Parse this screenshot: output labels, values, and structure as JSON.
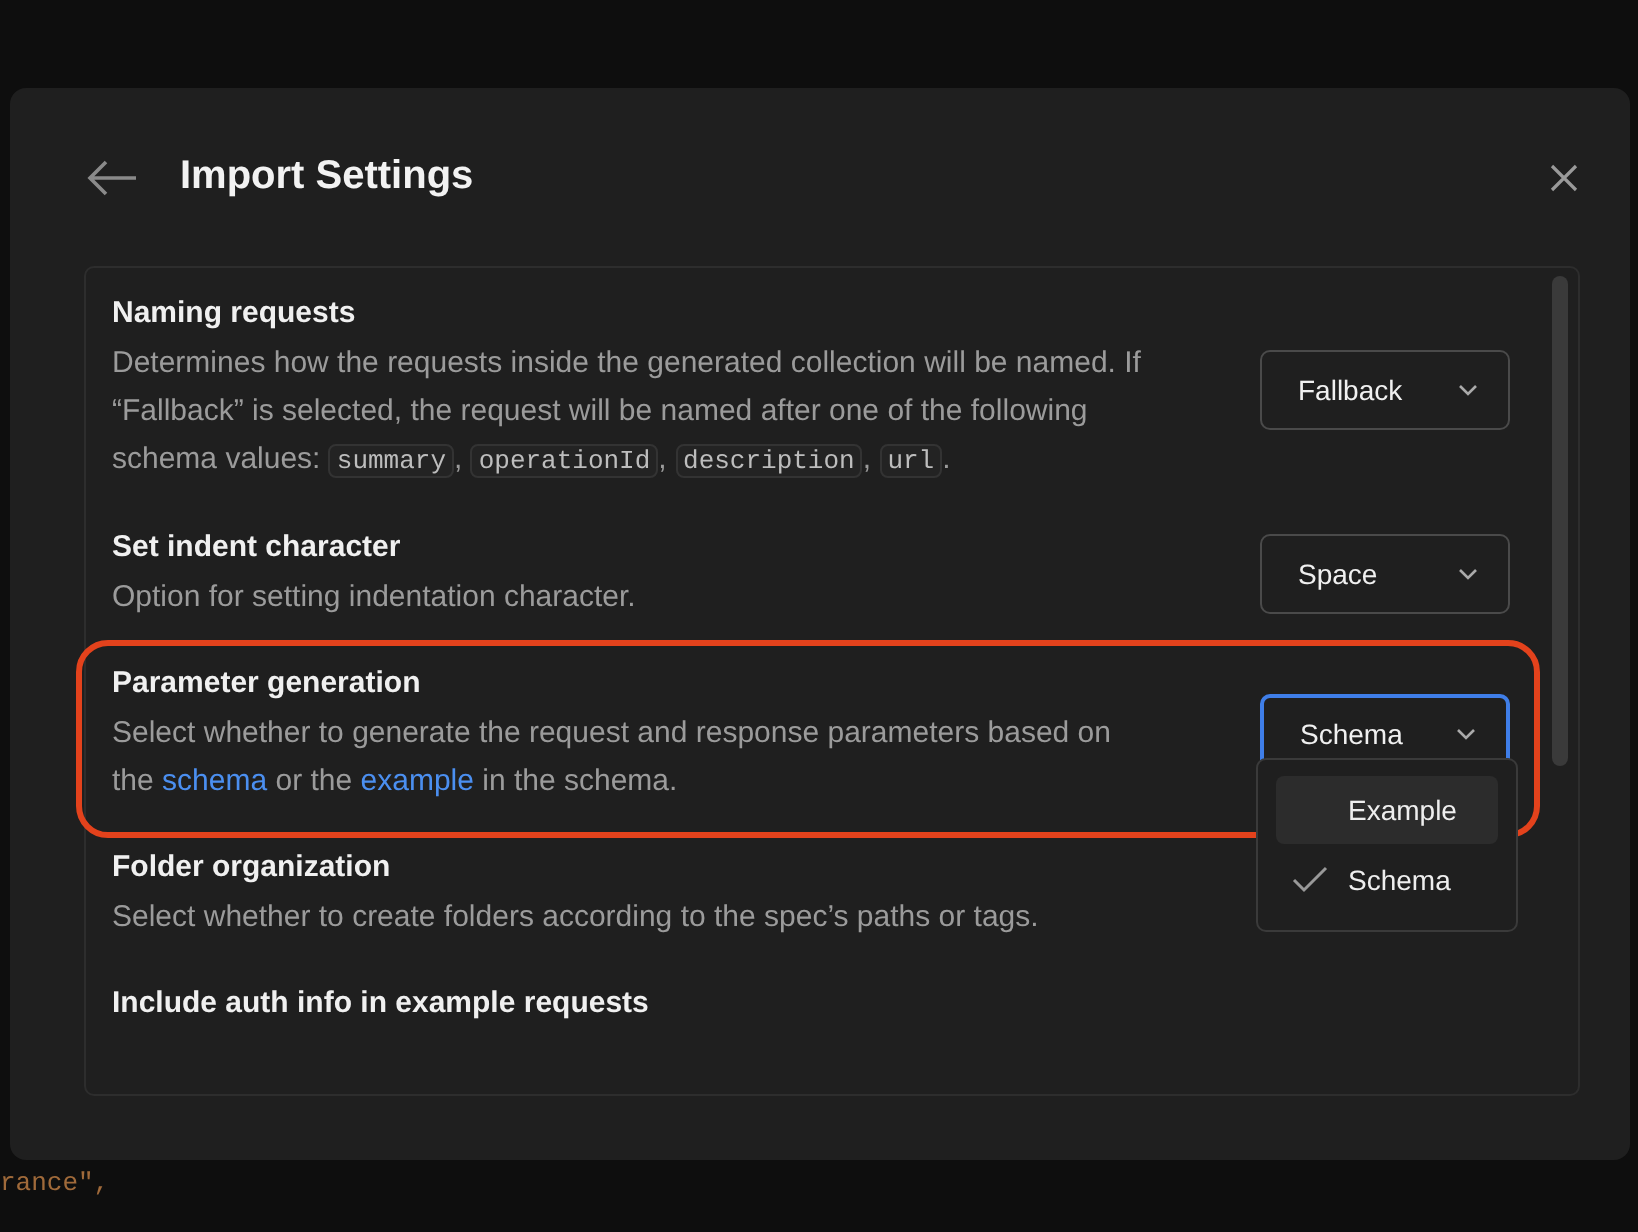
{
  "dialog": {
    "title": "Import Settings"
  },
  "settings": [
    {
      "title": "Naming requests",
      "highlighted": false,
      "description": [
        {
          "kind": "text",
          "text": "Determines how the requests inside the generated collection will be named. If “Fallback” is selected, the request will be named after one of the following schema values: "
        },
        {
          "kind": "code",
          "text": "summary"
        },
        {
          "kind": "text",
          "text": ", "
        },
        {
          "kind": "code",
          "text": "operationId"
        },
        {
          "kind": "text",
          "text": ", "
        },
        {
          "kind": "code",
          "text": "description"
        },
        {
          "kind": "text",
          "text": ", "
        },
        {
          "kind": "code",
          "text": "url"
        },
        {
          "kind": "text",
          "text": "."
        }
      ],
      "control": {
        "value": "Fallback",
        "focused": false
      }
    },
    {
      "title": "Set indent character",
      "highlighted": false,
      "description": [
        {
          "kind": "text",
          "text": "Option for setting indentation character."
        }
      ],
      "control": {
        "value": "Space",
        "focused": false
      }
    },
    {
      "title": "Parameter generation",
      "highlighted": true,
      "description": [
        {
          "kind": "text",
          "text": "Select whether to generate the request and response parameters based on the "
        },
        {
          "kind": "link",
          "text": "schema"
        },
        {
          "kind": "text",
          "text": " or the "
        },
        {
          "kind": "link",
          "text": "example"
        },
        {
          "kind": "text",
          "text": " in the schema."
        }
      ],
      "control": {
        "value": "Schema",
        "focused": true
      },
      "menu": [
        {
          "label": "Example",
          "hovered": true,
          "selected": false
        },
        {
          "label": "Schema",
          "hovered": false,
          "selected": true
        }
      ]
    },
    {
      "title": "Folder organization",
      "highlighted": false,
      "description": [
        {
          "kind": "text",
          "text": "Select whether to create folders according to the spec’s paths or tags."
        }
      ]
    },
    {
      "title": "Include auth info in example requests",
      "highlighted": false
    }
  ],
  "background_code": "rance\","
}
